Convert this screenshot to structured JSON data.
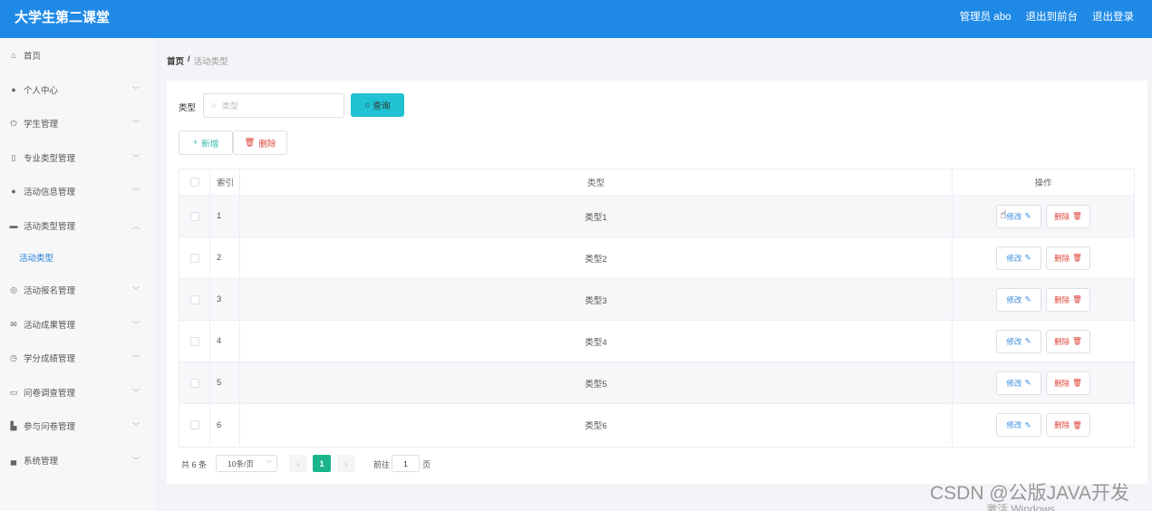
{
  "header": {
    "title": "大学生第二课堂",
    "admin": "管理员 abo",
    "front": "退出到前台",
    "logout": "退出登录"
  },
  "sidebar": {
    "items": [
      {
        "label": "首页",
        "icon": "home-icon"
      },
      {
        "label": "个人中心",
        "icon": "user-icon"
      },
      {
        "label": "学生管理",
        "icon": "power-icon"
      },
      {
        "label": "专业类型管理",
        "icon": "phone-icon"
      },
      {
        "label": "活动信息管理",
        "icon": "pin-icon"
      },
      {
        "label": "活动类型管理",
        "icon": "message-icon"
      },
      {
        "label": "活动报名管理",
        "icon": "globe-icon"
      },
      {
        "label": "活动成果管理",
        "icon": "mail-icon"
      },
      {
        "label": "学分成绩管理",
        "icon": "clock-icon"
      },
      {
        "label": "问卷调查管理",
        "icon": "chat-icon"
      },
      {
        "label": "参与问卷管理",
        "icon": "cart-icon"
      },
      {
        "label": "系统管理",
        "icon": "briefcase-icon"
      }
    ],
    "active_sub": "活动类型"
  },
  "breadcrumb": {
    "home": "首页",
    "sep": "/",
    "current": "活动类型"
  },
  "search": {
    "label": "类型",
    "placeholder": "类型",
    "button": "查询"
  },
  "toolbar": {
    "add": "新增",
    "delete": "删除"
  },
  "table": {
    "headers": {
      "index": "索引",
      "type": "类型",
      "ops": "操作"
    },
    "rows": [
      {
        "index": "1",
        "type": "类型1"
      },
      {
        "index": "2",
        "type": "类型2"
      },
      {
        "index": "3",
        "type": "类型3"
      },
      {
        "index": "4",
        "type": "类型4"
      },
      {
        "index": "5",
        "type": "类型5"
      },
      {
        "index": "6",
        "type": "类型6"
      }
    ],
    "edit_label": "修改",
    "delete_label": "删除"
  },
  "pagination": {
    "total": "共 6 条",
    "page_size": "10条/页",
    "current": "1",
    "goto_label": "前往",
    "goto_value": "1",
    "page_suffix": "页"
  },
  "watermark": {
    "text": "CSDN @公版JAVA开发",
    "windows": "激活 Windows"
  },
  "colors": {
    "header": "#1f8ae6",
    "query": "#20c1d1",
    "current_page": "#1bb58b",
    "danger": "#e0443b"
  }
}
